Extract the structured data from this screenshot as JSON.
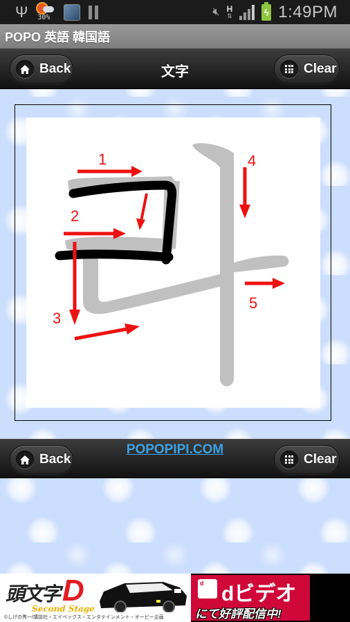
{
  "status_bar": {
    "weather_percent": "30%",
    "network_type": "H",
    "time": "1:49PM",
    "icons": [
      "usb-icon",
      "weather-icon",
      "scanner-app-icon",
      "pause-icon",
      "mute-icon",
      "hspa-data-icon",
      "signal-icon",
      "battery-charging-icon"
    ]
  },
  "app": {
    "title": "POPO 英語 韓国語"
  },
  "top_toolbar": {
    "back_label": "Back",
    "title": "文字",
    "clear_label": "Clear"
  },
  "canvas": {
    "guide_character": "콰",
    "stroke_numbers": [
      "1",
      "2",
      "3",
      "4",
      "5"
    ],
    "colors": {
      "guide": "#c0c0c0",
      "arrow": "#ee1111",
      "user_ink": "#000000"
    }
  },
  "bottom_toolbar": {
    "back_label": "Back",
    "site_link": "POPOPIPI.COM",
    "clear_label": "Clear"
  },
  "ad": {
    "left_title": "頭文字",
    "left_title_letter": "D",
    "left_subtitle": "Second Stage",
    "left_copyright": "©しげの秀一/講談社・エイベックス・エンタテインメント・オービー企画",
    "right_brand": "dビデオ",
    "right_tagline": "にて好評配信中!"
  }
}
